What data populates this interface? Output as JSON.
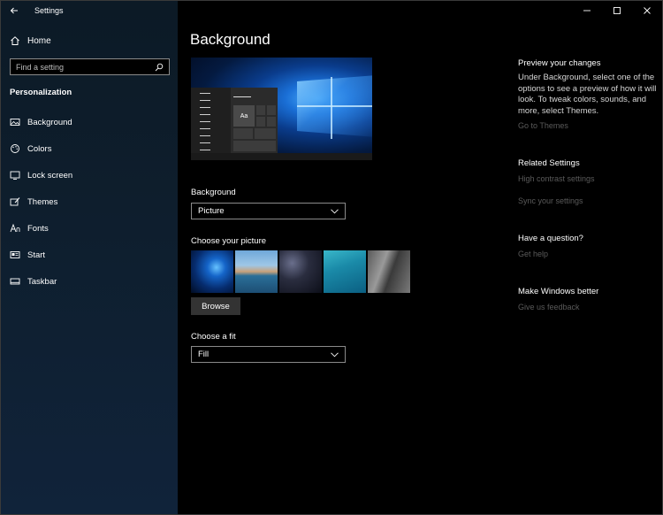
{
  "app": {
    "title": "Settings"
  },
  "sidebar": {
    "home_label": "Home",
    "search_placeholder": "Find a setting",
    "section_title": "Personalization",
    "items": [
      {
        "label": "Background",
        "icon": "picture-icon"
      },
      {
        "label": "Colors",
        "icon": "palette-icon"
      },
      {
        "label": "Lock screen",
        "icon": "monitor-icon"
      },
      {
        "label": "Themes",
        "icon": "brush-icon"
      },
      {
        "label": "Fonts",
        "icon": "fonts-icon"
      },
      {
        "label": "Start",
        "icon": "start-icon"
      },
      {
        "label": "Taskbar",
        "icon": "taskbar-icon"
      }
    ]
  },
  "main": {
    "page_title": "Background",
    "preview_tile_label": "Aa",
    "background_label": "Background",
    "background_value": "Picture",
    "choose_picture_label": "Choose your picture",
    "browse_label": "Browse",
    "fit_label": "Choose a fit",
    "fit_value": "Fill"
  },
  "right": {
    "preview_title": "Preview your changes",
    "preview_text": "Under Background, select one of the options to see a preview of how it will look. To tweak colors, sounds, and more, select Themes.",
    "go_to_themes": "Go to Themes",
    "related_title": "Related Settings",
    "high_contrast": "High contrast settings",
    "sync": "Sync your settings",
    "question_title": "Have a question?",
    "get_help": "Get help",
    "better_title": "Make Windows better",
    "feedback": "Give us feedback"
  },
  "colors": {
    "background": "#000000",
    "sidebar": "#0e1e2d",
    "disabled_link": "#5a5a5a",
    "button": "#333333"
  }
}
